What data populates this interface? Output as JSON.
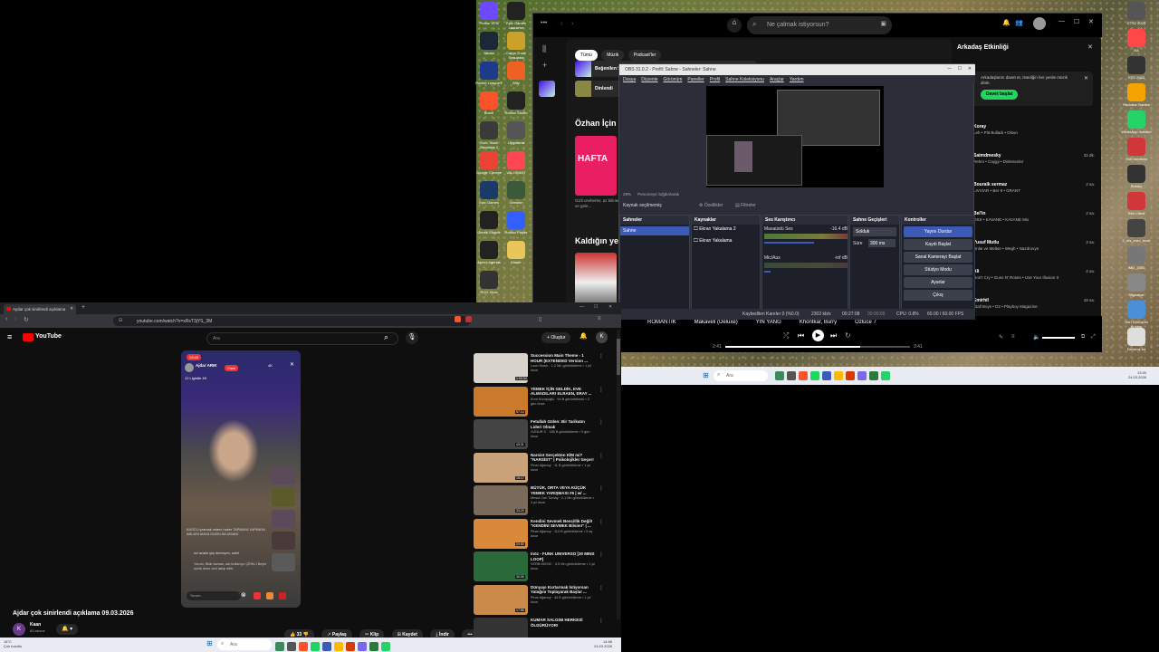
{
  "desktop": {
    "icons_left": [
      {
        "label": "Proton VPN",
        "color": "#6d4aff"
      },
      {
        "label": "Steam",
        "color": "#1b2838"
      },
      {
        "label": "Rocket League®",
        "color": "#1e3a8a"
      },
      {
        "label": "Brave",
        "color": "#fb542b"
      },
      {
        "label": "Euro Truck Simulator 2",
        "color": "#3a3a3a"
      },
      {
        "label": "Google Chrome",
        "color": "#ea4335"
      },
      {
        "label": "Epic Games",
        "color": "#1a3a6a"
      },
      {
        "label": "Unreal Engine",
        "color": "#222"
      },
      {
        "label": "Apex Legends",
        "color": "#222"
      },
      {
        "label": "ROG Xbox",
        "color": "#333"
      }
    ],
    "icons_col2": [
      {
        "label": "Epic Games Launcher",
        "color": "#222"
      },
      {
        "label": "Cargo Truck Simulator",
        "color": "#c9a227"
      },
      {
        "label": "Bitly",
        "color": "#ee6123"
      },
      {
        "label": "Roblox Studio",
        "color": "#222"
      },
      {
        "label": "Uygulama",
        "color": "#555"
      },
      {
        "label": "VALORANT",
        "color": "#ff4655"
      },
      {
        "label": "Genshin",
        "color": "#3a5a3a"
      },
      {
        "label": "Roblox Player",
        "color": "#335fff"
      },
      {
        "label": "Klasör",
        "color": "#e8c65a"
      }
    ],
    "icons_right": [
      {
        "label": "ETS2 2025",
        "color": "#555"
      },
      {
        "label": "EA",
        "color": "#ff4747"
      },
      {
        "label": "ETS 2023",
        "color": "#333"
      },
      {
        "label": "Rockstar Games",
        "color": "#f4a300"
      },
      {
        "label": "WhatsApp Installer",
        "color": "#25d366"
      },
      {
        "label": "Riot İstemcisi",
        "color": "#d13639"
      },
      {
        "label": "Roblox",
        "color": "#333"
      },
      {
        "label": "Riot Client",
        "color": "#d13639"
      },
      {
        "label": "2_ets_euro_truck",
        "color": "#444"
      },
      {
        "label": "IMG_2020",
        "color": "#777"
      },
      {
        "label": "Bilgisayar",
        "color": "#888"
      },
      {
        "label": "Geri Dönüşüm Kutusu",
        "color": "#4a90d9"
      },
      {
        "label": "Deneme.txt",
        "color": "#ddd"
      }
    ]
  },
  "spotify": {
    "search_placeholder": "Ne çalmak istiyorsun?",
    "chips": [
      "Tümü",
      "Müzik",
      "Podcast'ler"
    ],
    "rows": [
      "Beğenilen Şarkılar",
      "Dinlendi"
    ],
    "section1": "Özhan İçin",
    "section2": "Kaldığın yerden",
    "card_text": "HAFTA",
    "card_sub": "Gizli cevherler, az bilinenler ve gele...",
    "friends_title": "Arkadaş Etkinliği",
    "friends_invite": "Arkadaşlarını davet et, istediğin her yerde müzik dinle.",
    "friends_button": "Davet başlat",
    "friends": [
      {
        "name": "Koray",
        "track": "Leh • Pitt Bulladı",
        "sub": "Olsun",
        "time": ""
      },
      {
        "name": "Saimdmesky",
        "track": "Rehm • Cayjgi",
        "sub": "Dinlenenler",
        "time": "32 dk."
      },
      {
        "name": "Bouraik sermaz",
        "track": "LIVVIAR • Ber 9",
        "sub": "GRANT",
        "time": "2 sa."
      },
      {
        "name": "Bel'in",
        "track": "OSS • KAVANE",
        "sub": "KAVANE Mix",
        "time": "2 sa."
      },
      {
        "name": "Yusuf Mutlu",
        "track": "Unlie ve Meltse • Wegh",
        "sub": "Nazdrovye",
        "time": "3 sa."
      },
      {
        "name": "Ali",
        "track": "Don't Cry • Guns N' Roses",
        "sub": "Use Your Illusion II",
        "time": "4 sa."
      },
      {
        "name": "Emirhil",
        "track": "Stall Boys • D2",
        "sub": "Playboy Magazine",
        "time": "19 sa."
      }
    ],
    "now_playing": [
      "ROMANTİK",
      "Makaveli (Deluxe)",
      "YIN YANG",
      "Khontkar, Burry",
      "Özlüce 7"
    ],
    "time_current": "2:41",
    "time_total": "3:41"
  },
  "obs": {
    "title": "OBS 31.0.2 - Profil: Sahne - Sahneler: Sahne",
    "menu": [
      "Dosya",
      "Düzenle",
      "Görünüm",
      "Paneller",
      "Profil",
      "Sahne Koleksiyonu",
      "Araçlar",
      "Yardım"
    ],
    "source_label": "Kaynak seçilmemiş",
    "properties": "Özellikler",
    "filters": "Filtreler",
    "zoom": "29%",
    "zoom_mode": "Pencereye Sığdırılarak",
    "docks": {
      "scenes": "Sahneler",
      "sources": "Kaynaklar",
      "mixer": "Ses Karıştırıcı",
      "transitions": "Sahne Geçişleri",
      "controls": "Kontroller"
    },
    "scene_items": [
      "Sahne"
    ],
    "source_items": [
      "Ekran Yakalama 2",
      "Ekran Yakalama"
    ],
    "mixer_items": [
      {
        "name": "Masaüstü Ses",
        "db": "-16.4 dB"
      },
      {
        "name": "Mic/Aux",
        "db": "-inf dB"
      }
    ],
    "transition": "Solduk",
    "duration_label": "Süre",
    "duration": "300 ms",
    "controls": [
      "Yayını Durdur",
      "Kaydı Başlat",
      "Sanal Kamerayı Başlat",
      "Stüdyo Modu",
      "Ayarlar",
      "Çıkış"
    ],
    "status": {
      "dropped": "Kaybedilen Kareler 0 (%0.0)",
      "kbps": "2302 kb/s",
      "live": "00:27:08",
      "rec": "00:00:00",
      "cpu": "CPU: 0.8%",
      "fps": "60.00 / 60.00 FPS"
    }
  },
  "taskbar_right": {
    "search": "Ara",
    "time": "13:00",
    "date": "24.03.2026"
  },
  "browser": {
    "tab_title": "Aydar çok sinirlendi açıklama",
    "url": "youtube.com/watch?v=xRsT3jYS_3M",
    "search_placeholder": "Ara",
    "create_label": "Oluştur",
    "avatar_letter": "K",
    "video_title": "Ajdar çok sinirlendi açıklama 09.03.2026",
    "channel_name": "Kaan",
    "channel_subs": "83 abone",
    "actions": [
      "33",
      "Paylaş",
      "Klip",
      "Kaydet",
      "İndir"
    ],
    "video_overlay": {
      "live_badge": "23:48",
      "host": "Ajdar ARIK",
      "viewers": "4K",
      "tag": "Canlı",
      "caption": "12 Ligistte 4K",
      "chat1": "KUSCIJ yazmak ortamı haber TAPMAYA YAPMAYA ANLATA MAYA GÜZELİNİ ASIANI",
      "chat2": "ezi acaktı şey demeyen, sabri",
      "chat3": "Yorum, Bide kaman, adı kullanıyo ÇİRKLİ Beyin içerik lerez cevi takip ettik.",
      "input": "Yorum..."
    },
    "recs": [
      {
        "title": "Succession Main Theme - 1 HOUR (EXTENDED Version ...",
        "channel": "Loon Music",
        "meta": "1,2 Mn görüntüleme • 1 yıl önce",
        "dur": "1:00:34",
        "color": "#d8d4cc"
      },
      {
        "title": "YEMEK İÇİN GELDİK, EVE ALMADILAR! ELRAEN, ERAY ...",
        "channel": "Emri Kürüşoğlu",
        "meta": "54 B görüntüleme • 2 gün önce",
        "dur": "57:14",
        "color": "#c97a2a"
      },
      {
        "title": "Fetullah Gülen: Bir Tarikatın Lideri Olmak",
        "channel": "OZNUR X",
        "meta": "165 B görüntüleme • 3 gün önce",
        "dur": "43:31",
        "color": "#444"
      },
      {
        "title": "Narsist Gerçekten KİM mi? \"NARSİST\" | Psikolojikler Geçer!",
        "channel": "Pinar Ağanoy",
        "meta": "11 B görüntüleme • 1 yıl önce",
        "dur": "15:17",
        "color": "#c9a27a"
      },
      {
        "title": "BÜYÜK, ORTA VEYA KÜÇÜK YEMEK YARIŞMASI #6 | w/ ...",
        "channel": "Mesut Can Tomay",
        "meta": "2,1 Mn görüntüleme • 3 yıl önce",
        "dur": "33:29",
        "color": "#7a6a5a"
      },
      {
        "title": "Kendini Sevmek Bencillik Değil! \"KENDİNİ SEVMEK Bilsim!\" | ...",
        "channel": "Pinar Ağanoy",
        "meta": "113 B görüntüleme • 5 ay önce",
        "dur": "20:50",
        "color": "#d88a3a"
      },
      {
        "title": "Inöz - FUNK UNIVERSO [30 MINS LOOP]",
        "channel": "VERB MUSIC",
        "meta": "3,5 Mn görüntüleme • 1 yıl önce",
        "dur": "30:05",
        "color": "#2a6a3a"
      },
      {
        "title": "Dünyayı Kurtarmak İstiyorsan Yatağını Toplayarak Başla! ...",
        "channel": "Pinar Ağanoy",
        "meta": "44 B görüntüleme • 1 yıl önce",
        "dur": "17:56",
        "color": "#c98a4a"
      },
      {
        "title": "KUMAR SALGINI HERKESİ ÖLDÜRÜYOR!",
        "channel": "",
        "meta": "",
        "dur": "",
        "color": "#333"
      }
    ]
  },
  "taskbar_left": {
    "weather_temp": "18°C",
    "weather_desc": "Çok bulutlu",
    "search": "Ara",
    "time": "14:56",
    "date": "24.03.2026"
  },
  "colors": {
    "spotify_green": "#1ed760",
    "youtube_red": "#ff0000",
    "obs_active": "#3c5ab8"
  }
}
